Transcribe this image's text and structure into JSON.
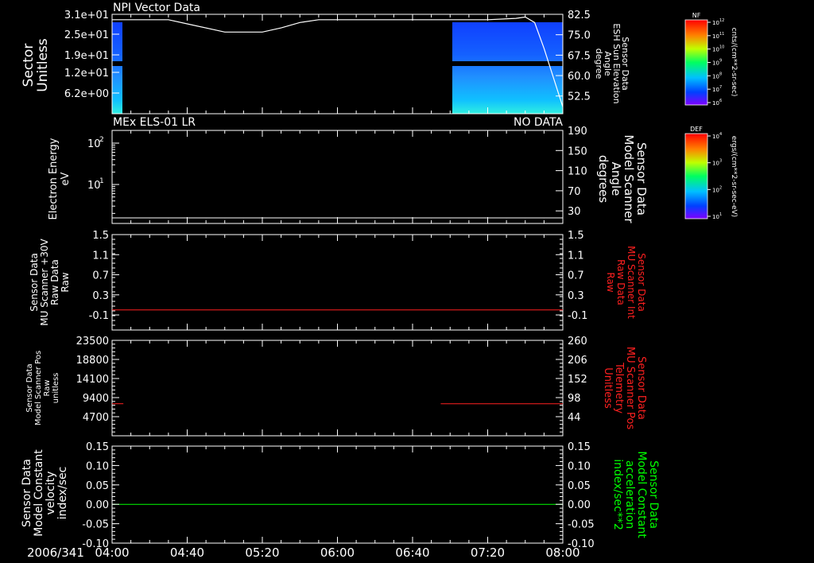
{
  "chart_data": [
    {
      "type": "heatmap",
      "title": "NPI Vector Data",
      "ylabel_left": [
        "Sector",
        "Unitless"
      ],
      "ylabel_right": [
        "Sensor Data",
        "ESH Sun Elevation",
        "Angle",
        "degree"
      ],
      "yticks_left": [
        "3.1e+01",
        "2.5e+01",
        "1.9e+01",
        "1.2e+01",
        "6.2e+00"
      ],
      "yticks_right": [
        "82.5",
        "75.0",
        "67.5",
        "60.0",
        "52.5"
      ],
      "ylim_right": [
        46,
        82.5
      ],
      "overlay_line": {
        "x": [
          "04:00",
          "04:20",
          "04:30",
          "04:40",
          "05:00",
          "05:20",
          "05:30",
          "05:40",
          "05:50",
          "06:00",
          "06:20",
          "06:40",
          "07:00",
          "07:10",
          "07:20",
          "07:35",
          "07:40",
          "07:45",
          "07:50",
          "08:00"
        ],
        "y": [
          80.5,
          80.5,
          80.5,
          79.0,
          76.0,
          76.0,
          77.5,
          79.5,
          80.5,
          80.5,
          80.5,
          80.5,
          80.5,
          80.5,
          80.5,
          81.0,
          81.5,
          79.5,
          70.0,
          48.5
        ]
      },
      "data_intervals": [
        [
          "04:00",
          "04:06"
        ],
        [
          "06:55",
          "08:00"
        ]
      ]
    },
    {
      "type": "line",
      "title": "MEx ELS-01 LR",
      "annotation": "NO DATA",
      "ylabel_left": [
        "Electron Energy",
        "eV"
      ],
      "ylabel_right": [
        "Sensor Data",
        "Model Scanner",
        "Angle",
        "degrees"
      ],
      "yticks_left_base": [
        "10",
        "10"
      ],
      "yticks_left_exp": [
        "2",
        "1"
      ],
      "yticks_right": [
        "190",
        "150",
        "110",
        "70",
        "30"
      ],
      "ylim_right": [
        5,
        190
      ],
      "series": [
        {
          "x": [
            "04:00",
            "08:00"
          ],
          "y": [
            10,
            10
          ],
          "color": "#ffffff"
        }
      ]
    },
    {
      "type": "line",
      "ylabel_left": [
        "Sensor Data",
        "MU Scanner +30V",
        "Raw Data",
        "Raw"
      ],
      "ylabel_right": [
        "Sensor Data",
        "MU Scanner Int",
        "Raw Data",
        "Raw"
      ],
      "yticks_left": [
        "1.5",
        "1.1",
        "0.7",
        "0.3",
        "-0.1"
      ],
      "yticks_right": [
        "1.5",
        "1.1",
        "0.7",
        "0.3",
        "-0.1"
      ],
      "ylim": [
        -0.4,
        1.5
      ],
      "series": [
        {
          "x": [
            "04:00",
            "08:00"
          ],
          "y": [
            0.0,
            0.0
          ],
          "color": "#ff2020"
        }
      ]
    },
    {
      "type": "line",
      "ylabel_left": [
        "Sensor Data",
        "Model Scanner Pos",
        "Raw",
        "unitless"
      ],
      "ylabel_right": [
        "Sensor Data",
        "MU Scanner Pos",
        "Telemetry",
        "Unitless"
      ],
      "yticks_left": [
        "23500",
        "18800",
        "14100",
        "9400",
        "4700"
      ],
      "yticks_right": [
        "260",
        "206",
        "152",
        "98",
        "44"
      ],
      "ylim_left": [
        0,
        23500
      ],
      "series": [
        {
          "x": [
            "04:00",
            "04:06"
          ],
          "y": [
            7900,
            7900
          ],
          "color": "#ff2020"
        },
        {
          "x": [
            "06:55",
            "08:00"
          ],
          "y": [
            7900,
            7900
          ],
          "color": "#ff2020"
        }
      ]
    },
    {
      "type": "line",
      "ylabel_left": [
        "Sensor Data",
        "Model Constant",
        "velocity",
        "index/sec"
      ],
      "ylabel_right": [
        "Sensor Data",
        "Model Constant",
        "acceleration",
        "index/sec**2"
      ],
      "yticks_left": [
        "0.15",
        "0.10",
        "0.05",
        "0.00",
        "-0.05",
        "-0.10"
      ],
      "yticks_right": [
        "0.15",
        "0.10",
        "0.05",
        "0.00",
        "-0.05",
        "-0.10"
      ],
      "ylim": [
        -0.1,
        0.15
      ],
      "series": [
        {
          "x": [
            "04:00",
            "08:00"
          ],
          "y": [
            0.0,
            0.0
          ],
          "color": "#00ff00"
        }
      ]
    }
  ],
  "x_axis": {
    "date": "2006/341",
    "ticks": [
      "04:00",
      "04:40",
      "05:20",
      "06:00",
      "06:40",
      "07:20",
      "08:00"
    ]
  },
  "colorbars": [
    {
      "label": "NF",
      "units": "cnts/(cm**2-sr-sec)",
      "tick_base": [
        "10",
        "10",
        "10",
        "10",
        "10",
        "10",
        "10"
      ],
      "tick_exp": [
        "12",
        "11",
        "10",
        "9",
        "8",
        "7",
        "6"
      ]
    },
    {
      "label": "DEF",
      "units": "ergs/(cm**2-sr-sec-eV)",
      "tick_base": [
        "10",
        "10",
        "10",
        "10"
      ],
      "tick_exp": [
        "4",
        "3",
        "2",
        "1"
      ]
    }
  ],
  "colors": {
    "text": "#ffffff",
    "red_label": "#ff2020",
    "green_label": "#00ff00",
    "background": "#000000"
  }
}
